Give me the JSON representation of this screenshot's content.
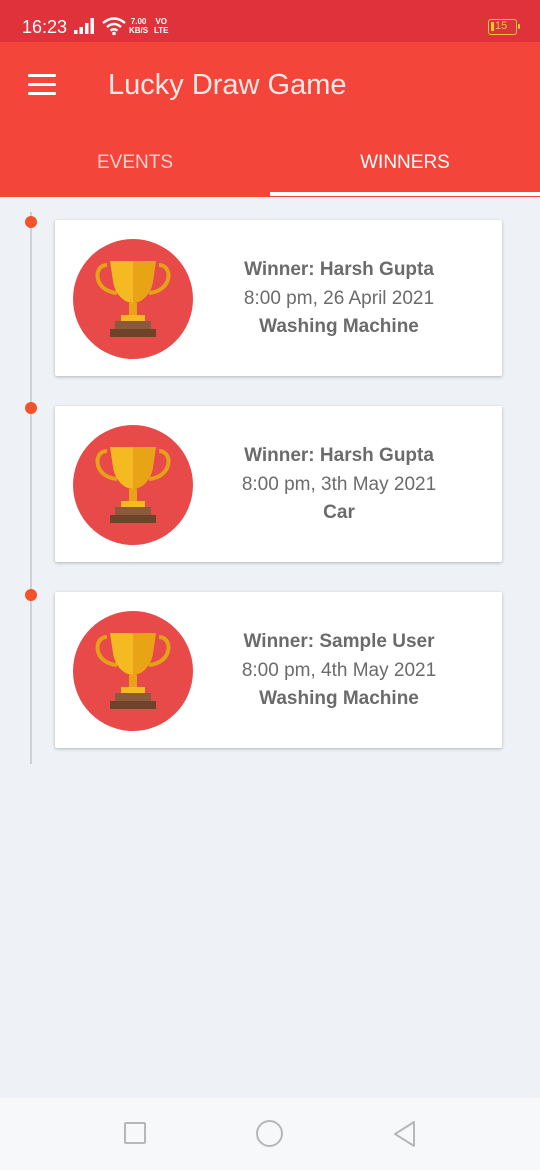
{
  "status_bar": {
    "time": "16:23",
    "net_speed_value": "7.00",
    "net_speed_unit": "KB/S",
    "net_type_top": "VO",
    "net_type_bottom": "LTE",
    "battery_level": "15"
  },
  "app_bar": {
    "title": "Lucky Draw Game",
    "menu_icon": "hamburger-menu-icon"
  },
  "tabs": [
    {
      "label": "EVENTS",
      "selected": false
    },
    {
      "label": "WINNERS",
      "selected": true
    }
  ],
  "winners": [
    {
      "winner": "Winner: Harsh Gupta",
      "datetime": "8:00 pm, 26 April 2021",
      "prize": "Washing Machine",
      "icon": "trophy-icon"
    },
    {
      "winner": "Winner: Harsh Gupta",
      "datetime": "8:00 pm, 3th May 2021",
      "prize": "Car",
      "icon": "trophy-icon"
    },
    {
      "winner": "Winner: Sample User",
      "datetime": "8:00 pm, 4th May 2021",
      "prize": "Washing Machine",
      "icon": "trophy-icon"
    }
  ],
  "nav_bar": {
    "icons": [
      "recent-apps-icon",
      "home-icon",
      "back-icon"
    ]
  },
  "colors": {
    "status_bar": "#e0323a",
    "app_bar": "#f4453a",
    "timeline_dot": "#f4522a",
    "avatar_bg": "#e84a4a",
    "trophy_gold": "#f5b921",
    "background": "#eef1f5"
  }
}
